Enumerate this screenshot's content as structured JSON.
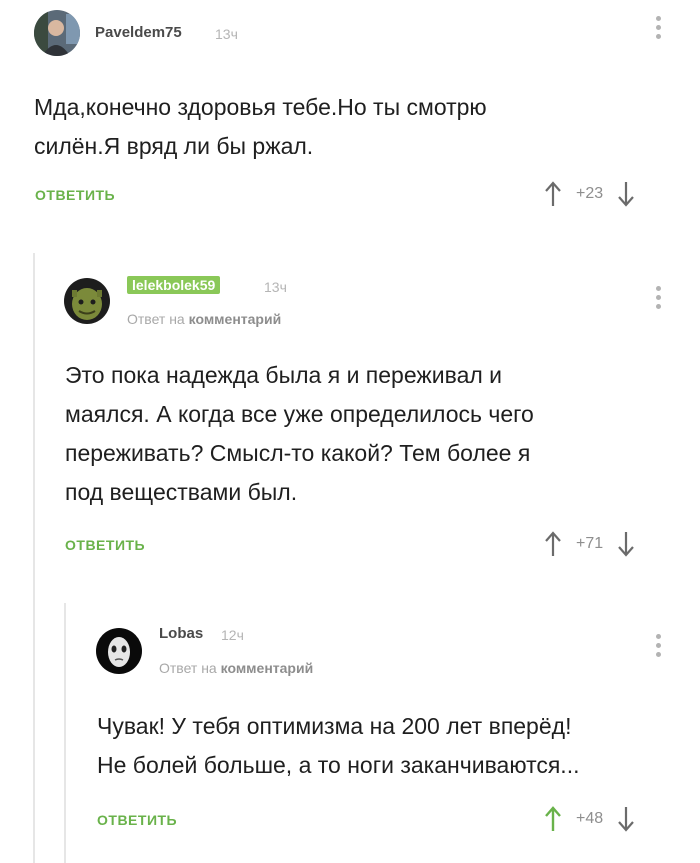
{
  "comments": [
    {
      "username": "Paveldem75",
      "time": "13ч",
      "text_lines": [
        "Мда,конечно здоровья тебе.Но ты смотрю",
        "силён.Я вряд ли бы ржал."
      ],
      "reply_label": "ОТВЕТИТЬ",
      "score": "+23"
    },
    {
      "username": "lelekbolek59",
      "time": "13ч",
      "reply_prefix": "Ответ на",
      "reply_target": "комментарий",
      "text_lines": [
        "Это пока надежда была я и переживал и",
        "маялся. А когда все уже определилось чего",
        "переживать? Смысл-то какой? Тем более я",
        "под веществами был."
      ],
      "reply_label": "ОТВЕТИТЬ",
      "score": "+71"
    },
    {
      "username": "Lobas",
      "time": "12ч",
      "reply_prefix": "Ответ на",
      "reply_target": "комментарий",
      "text_lines": [
        "Чувак! У тебя оптимизма на 200 лет вперёд!",
        "Не болей больше, а то ноги заканчиваются..."
      ],
      "reply_label": "ОТВЕТИТЬ",
      "score": "+48"
    }
  ],
  "colors": {
    "accent_green": "#69b24a",
    "username_badge": "#8ac858",
    "upvoted_arrow": "#69b24a"
  },
  "icons": [
    "user-avatar",
    "upvote-arrow-icon",
    "downvote-arrow-icon",
    "more-options-icon"
  ]
}
